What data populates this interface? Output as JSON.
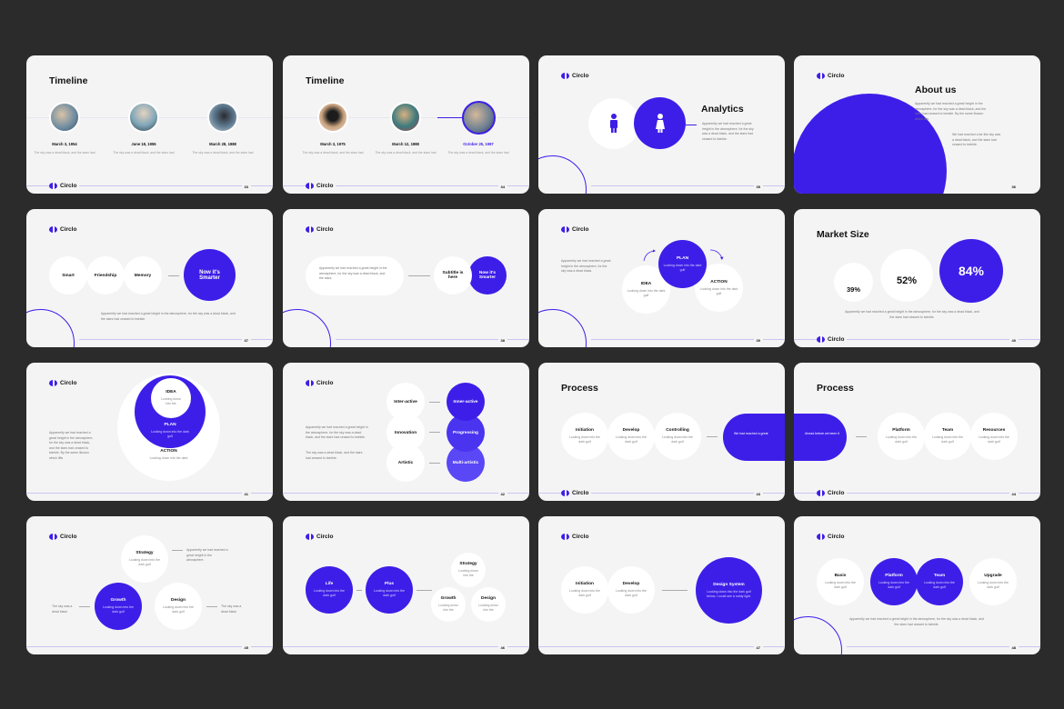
{
  "brand": {
    "name": "Circlo",
    "accent": "#3d1ee8",
    "background": "#2b2b2b",
    "slide_bg": "#f4f4f5"
  },
  "slides": [
    {
      "page": "33",
      "title": "Timeline",
      "items": [
        {
          "date": "March 3, 1954",
          "text": "The sky was a dead black, and the stars had"
        },
        {
          "date": "June 18, 1955",
          "text": "The sky was a dead black, and the stars had"
        },
        {
          "date": "March 28, 1988",
          "text": "The sky was a dead black, and the stars had"
        }
      ]
    },
    {
      "page": "34",
      "title": "Timeline",
      "items": [
        {
          "date": "March 3, 1975",
          "text": "The sky was a dead black, and the stars had"
        },
        {
          "date": "March 12, 1988",
          "text": "The sky was a dead black, and the stars had"
        },
        {
          "date": "October 25, 1987",
          "text": "The sky was a dead black, and the stars had"
        }
      ]
    },
    {
      "page": "35",
      "title": "Analytics",
      "body": "Apparently we had reached a great height in the atmosphere, for the sky was a dead black, and the stars had ceased to twinkle."
    },
    {
      "page": "36",
      "title": "About us",
      "body1": "Apparently we had reached a great height in the atmosphere, for the sky was a dead black, and the stars had ceased to twinkle. By the same illusion which lifts",
      "body2": "We had reached a far like sky was a dead black, and the stars had ceased to twinkle."
    },
    {
      "page": "37",
      "items": [
        "Smart",
        "Friendship",
        "Memory"
      ],
      "highlight": "Now it's Smarter",
      "body": "Apparently we had reached a great height in the atmosphere, for the sky was a dead black, and the stars had ceased to twinkle."
    },
    {
      "page": "38",
      "pill_text": "Apparently we had reached a great height in the atmosphere, for the sky was a dead black, and the stars.",
      "subtitle": "Subtitle is here",
      "highlight": "Now it's Smarter"
    },
    {
      "page": "39",
      "body": "Apparently we had reached a great height in the atmosphere, for the sky was a dead black.",
      "items": [
        {
          "label": "PLAN",
          "text": "Looking down into the dark gulf"
        },
        {
          "label": "IDEA",
          "text": "Looking down into the dark gulf"
        },
        {
          "label": "ACTION",
          "text": "Looking down into the dark gulf"
        }
      ]
    },
    {
      "page": "40",
      "title": "Market Size",
      "values": [
        "39%",
        "52%",
        "84%"
      ],
      "body": "Apparently we had reached a great height in the atmosphere, for the sky was a dead black, and the stars had ceased to twinkle."
    },
    {
      "page": "41",
      "body": "Apparently we had reached a great height in the atmosphere, for the sky was a dead black, and the stars had ceased to twinkle. By the same illusion which lifts",
      "items": [
        {
          "label": "IDEA",
          "text": "Looking down into the"
        },
        {
          "label": "PLAN",
          "text": "Looking down into the dark gulf"
        },
        {
          "label": "ACTION",
          "text": "Looking down into the dark"
        }
      ]
    },
    {
      "page": "42",
      "body1": "Apparently we had reached a great height in the atmosphere, for the sky was a dead black, and the stars had ceased to twinkle.",
      "body2": "The sky was a dead black, and the stars had ceased to twinkle.",
      "left": [
        "Inter-active",
        "Innovation",
        "Artistic"
      ],
      "right": [
        "Inner-active",
        "Progressing",
        "Multi-artistic"
      ]
    },
    {
      "page": "43",
      "title": "Process",
      "items": [
        {
          "label": "Initiation",
          "text": "Looking down into the dark gulf"
        },
        {
          "label": "Develop",
          "text": "Looking down into the dark gulf"
        },
        {
          "label": "Controlling",
          "text": "Looking down into the dark gulf"
        }
      ],
      "pill": "We had reached a great"
    },
    {
      "page": "44",
      "title": "Process",
      "pill": "Ahead before we been it",
      "items": [
        {
          "label": "Platform",
          "text": "Looking down into the dark gulf"
        },
        {
          "label": "Team",
          "text": "Looking down into the dark gulf"
        },
        {
          "label": "Resources",
          "text": "Looking down into the dark gulf"
        }
      ]
    },
    {
      "page": "45",
      "items": [
        {
          "label": "Strategy",
          "text": "Looking down into the dark gulf"
        },
        {
          "label": "Growth",
          "text": "Looking down into the dark gulf"
        },
        {
          "label": "Design",
          "text": "Looking down into the dark gulf"
        }
      ],
      "note_top": "Apparently we had reached a great height in the atmosphere.",
      "note_left": "The sky was a dead black",
      "note_right": "The sky was a dead black"
    },
    {
      "page": "46",
      "items": [
        {
          "label": "Life",
          "text": "Looking down into the dark gulf"
        },
        {
          "label": "Plus",
          "text": "Looking down into the dark gulf"
        },
        {
          "label": "Strategy",
          "text": "Looking down into the"
        },
        {
          "label": "Growth",
          "text": "Looking down into the"
        },
        {
          "label": "Design",
          "text": "Looking down into the"
        }
      ]
    },
    {
      "page": "47",
      "items": [
        {
          "label": "Initiation",
          "text": "Looking down into the dark gulf"
        },
        {
          "label": "Develop",
          "text": "Looking down into the dark gulf"
        }
      ],
      "highlight": {
        "label": "Design System",
        "text": "Looking down into the dark gulf below, I could see a ruddy light."
      }
    },
    {
      "page": "48",
      "items": [
        {
          "label": "Basis",
          "text": "Looking down into the dark gulf"
        },
        {
          "label": "Platform",
          "text": "Looking down into the dark gulf"
        },
        {
          "label": "Team",
          "text": "Looking down into the dark gulf"
        },
        {
          "label": "Upgrade",
          "text": "Looking down into the dark gulf"
        }
      ],
      "body": "Apparently we had reached a great height in the atmosphere, for the sky was a dead black, and the stars had ceased to twinkle."
    }
  ]
}
